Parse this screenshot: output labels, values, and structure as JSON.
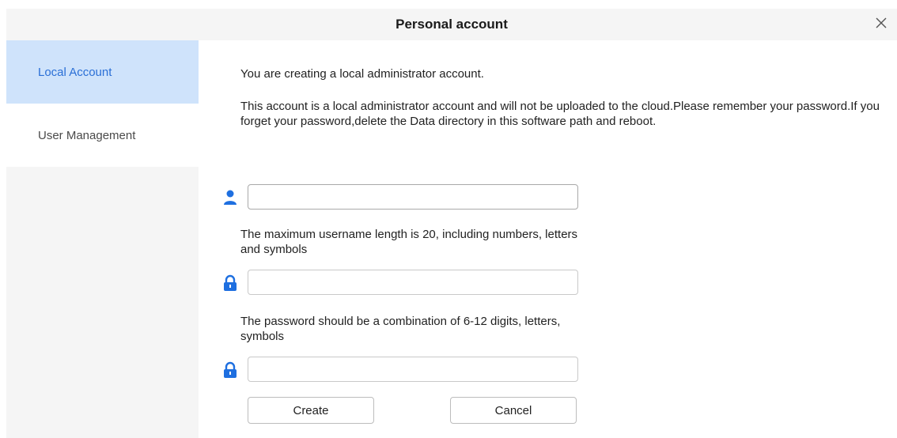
{
  "window": {
    "title": "Personal account",
    "close_icon": "close-icon"
  },
  "sidebar": {
    "items": [
      {
        "label": "Local Account",
        "active": true
      },
      {
        "label": "User Management",
        "active": false
      }
    ]
  },
  "main": {
    "intro": "You are creating a local administrator account.",
    "note": "This account is a local administrator account and will not be uploaded to the cloud.Please remember your password.If you forget your password,delete the Data directory in this software path and reboot.",
    "username": {
      "icon": "user-icon",
      "value": "",
      "hint": "The maximum username length is 20, including numbers, letters and symbols"
    },
    "password": {
      "icon": "lock-icon",
      "value": "",
      "hint": "The password should be a combination of 6-12 digits, letters, symbols"
    },
    "confirm_password": {
      "icon": "lock-icon",
      "value": ""
    },
    "buttons": {
      "create": "Create",
      "cancel": "Cancel"
    }
  },
  "colors": {
    "accent": "#1e6fe0",
    "active_sidebar_bg": "#cfe3fb",
    "active_sidebar_text": "#2a6fd6",
    "panel_bg": "#f5f5f5"
  }
}
